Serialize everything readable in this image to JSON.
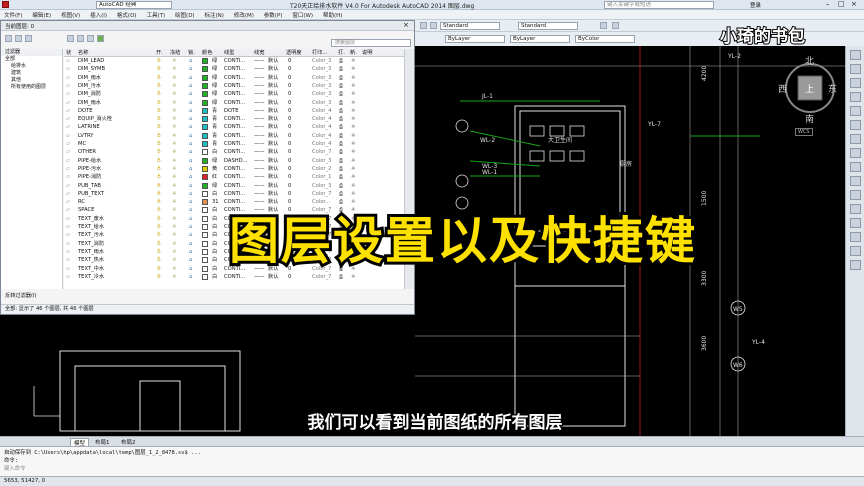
{
  "window": {
    "title": "T20天正给排水软件 V4.0 For Autodesk AutoCAD 2014    图层.dwg",
    "workspace": "AutoCAD 经典",
    "search_placeholder": "键入关键字或短语",
    "login_label": "登录"
  },
  "menu": [
    "文件(F)",
    "编辑(E)",
    "视图(V)",
    "插入(I)",
    "格式(O)",
    "工具(T)",
    "绘图(D)",
    "标注(N)",
    "修改(M)",
    "参数(P)",
    "窗口(W)",
    "帮助(H)"
  ],
  "properties_bar": {
    "text_style": "Standard",
    "dim_style": "Standard",
    "color": "ByLayer",
    "linetype": "ByLayer",
    "lineweight": "ByColor"
  },
  "layer_panel": {
    "title": "当前图层: 0",
    "search_placeholder": "搜索图层",
    "tree": [
      "过滤器",
      "全部",
      "给排水",
      "建筑",
      "其他",
      "所有使用的图层"
    ],
    "invert_filter_label": "反转过滤器(I)",
    "status": "全部: 显示了 46 个图层, 共 46 个图层",
    "columns": [
      "状",
      "名称",
      "开.",
      "冻结",
      "锁.",
      "颜色",
      "线型",
      "线宽",
      "透明度",
      "打印...",
      "打.",
      "新.",
      "说明"
    ],
    "rows": [
      {
        "name": "DIM_LEAD",
        "color_name": "绿",
        "color": "#20b020",
        "linetype": "CONTI...",
        "lw": "默认",
        "tr": "0",
        "plot": "Color_3"
      },
      {
        "name": "DIM_SYMB",
        "color_name": "绿",
        "color": "#20b020",
        "linetype": "CONTI...",
        "lw": "默认",
        "tr": "0",
        "plot": "Color_3"
      },
      {
        "name": "DIM_雨水",
        "color_name": "绿",
        "color": "#20b020",
        "linetype": "CONTI...",
        "lw": "默认",
        "tr": "0",
        "plot": "Color_3"
      },
      {
        "name": "DIM_污水",
        "color_name": "绿",
        "color": "#20b020",
        "linetype": "CONTI...",
        "lw": "默认",
        "tr": "0",
        "plot": "Color_3"
      },
      {
        "name": "DIM_消防",
        "color_name": "绿",
        "color": "#20b020",
        "linetype": "CONTI...",
        "lw": "默认",
        "tr": "0",
        "plot": "Color_3"
      },
      {
        "name": "DIM_雨水",
        "color_name": "绿",
        "color": "#20b020",
        "linetype": "CONTI...",
        "lw": "默认",
        "tr": "0",
        "plot": "Color_3"
      },
      {
        "name": "DOTE",
        "color_name": "青",
        "color": "#20c0c0",
        "linetype": "DOTE",
        "lw": "默认",
        "tr": "0",
        "plot": "Color_4"
      },
      {
        "name": "EQUIP_消火栓",
        "color_name": "青",
        "color": "#20c0c0",
        "linetype": "CONTI...",
        "lw": "默认",
        "tr": "0",
        "plot": "Color_4"
      },
      {
        "name": "LATRINE",
        "color_name": "青",
        "color": "#20c0c0",
        "linetype": "CONTI...",
        "lw": "默认",
        "tr": "0",
        "plot": "Color_4"
      },
      {
        "name": "LVTRY",
        "color_name": "青",
        "color": "#20c0c0",
        "linetype": "CONTI...",
        "lw": "默认",
        "tr": "0",
        "plot": "Color_4"
      },
      {
        "name": "MC",
        "color_name": "青",
        "color": "#20c0c0",
        "linetype": "CONTI...",
        "lw": "默认",
        "tr": "0",
        "plot": "Color_4"
      },
      {
        "name": "OTHER",
        "color_name": "白",
        "color": "#ffffff",
        "linetype": "CONTI...",
        "lw": "默认",
        "tr": "0",
        "plot": "Color_7"
      },
      {
        "name": "PIPE-给水",
        "color_name": "绿",
        "color": "#20b020",
        "linetype": "DASHD...",
        "lw": "默认",
        "tr": "0",
        "plot": "Color_3"
      },
      {
        "name": "PIPE-污水",
        "color_name": "黄",
        "color": "#e0d000",
        "linetype": "CONTI...",
        "lw": "默认",
        "tr": "0",
        "plot": "Color_2"
      },
      {
        "name": "PIPE-消防",
        "color_name": "红",
        "color": "#e02020",
        "linetype": "CONTI...",
        "lw": "默认",
        "tr": "0",
        "plot": "Color_1"
      },
      {
        "name": "PUB_TAB",
        "color_name": "绿",
        "color": "#20b020",
        "linetype": "CONTI...",
        "lw": "默认",
        "tr": "0",
        "plot": "Color_3"
      },
      {
        "name": "PUB_TEXT",
        "color_name": "白",
        "color": "#ffffff",
        "linetype": "CONTI...",
        "lw": "默认",
        "tr": "0",
        "plot": "Color_7"
      },
      {
        "name": "RC",
        "color_name": "31",
        "color": "#e09050",
        "linetype": "CONTI...",
        "lw": "默认",
        "tr": "0",
        "plot": "Color..."
      },
      {
        "name": "SPACE",
        "color_name": "白",
        "color": "#ffffff",
        "linetype": "CONTI...",
        "lw": "默认",
        "tr": "0",
        "plot": "Color_7"
      },
      {
        "name": "TEXT_废水",
        "color_name": "白",
        "color": "#ffffff",
        "linetype": "CONTI...",
        "lw": "默认",
        "tr": "0",
        "plot": "Color_7"
      },
      {
        "name": "TEXT_给水",
        "color_name": "白",
        "color": "#ffffff",
        "linetype": "CONTI...",
        "lw": "默认",
        "tr": "0",
        "plot": "Color_7"
      },
      {
        "name": "TEXT_污水",
        "color_name": "白",
        "color": "#ffffff",
        "linetype": "CONTI...",
        "lw": "默认",
        "tr": "0",
        "plot": "Color_7"
      },
      {
        "name": "TEXT_消防",
        "color_name": "白",
        "color": "#ffffff",
        "linetype": "CONTI...",
        "lw": "默认",
        "tr": "0",
        "plot": "Color_7"
      },
      {
        "name": "TEXT_雨水",
        "color_name": "白",
        "color": "#ffffff",
        "linetype": "CONTI...",
        "lw": "默认",
        "tr": "0",
        "plot": "Color_7"
      },
      {
        "name": "TEXT_热水",
        "color_name": "白",
        "color": "#ffffff",
        "linetype": "CONTI...",
        "lw": "默认",
        "tr": "0",
        "plot": "Color_7"
      },
      {
        "name": "TEXT_中水",
        "color_name": "白",
        "color": "#ffffff",
        "linetype": "CONTI...",
        "lw": "默认",
        "tr": "0",
        "plot": "Color_7"
      },
      {
        "name": "TEXT_冷水",
        "color_name": "白",
        "color": "#ffffff",
        "linetype": "CONTI...",
        "lw": "默认",
        "tr": "0",
        "plot": "Color_7"
      }
    ]
  },
  "viewcube": {
    "north": "北",
    "south": "南",
    "east": "东",
    "west": "西",
    "top": "上",
    "wcs": "WCS"
  },
  "drawing_labels": [
    "JL-1",
    "WL-2",
    "WL-3",
    "WL-1",
    "YL-7",
    "YL-2",
    "YL-4",
    "W5",
    "W6",
    "大卫生间",
    "厨房",
    "4200",
    "1500",
    "3300",
    "3600"
  ],
  "layout_tabs": [
    "模型",
    "布局1",
    "布局2"
  ],
  "cmdline": {
    "line1": "自动保存到 C:\\Users\\hp\\appdata\\local\\temp\\图层_1_2_8478.sv$ ...",
    "line2": "命令:",
    "prompt": "键入命令"
  },
  "status": {
    "coords": "5653, 51427, 0"
  },
  "overlay": {
    "brand": "小琦的书包",
    "headline": "图层设置以及快捷键",
    "subtitle": "我们可以看到当前图纸的所有图层"
  },
  "colors": {
    "canvas": "#000000",
    "headline": "#ffe100",
    "accent": "#2d6aa8"
  }
}
